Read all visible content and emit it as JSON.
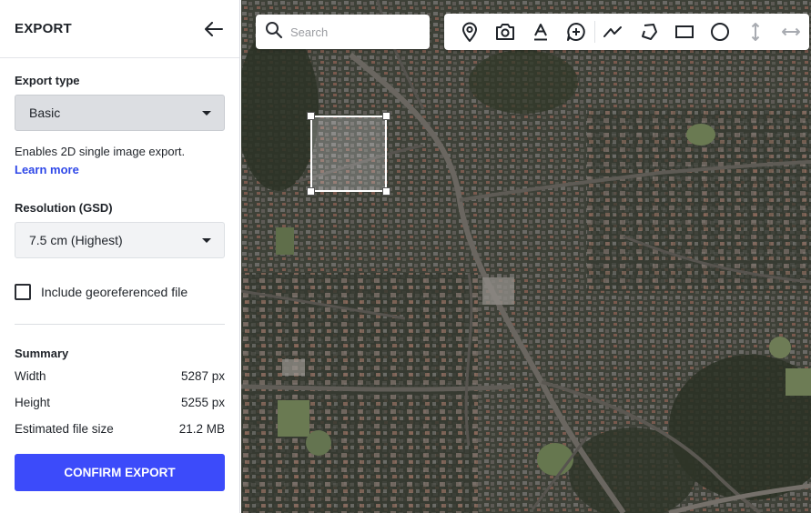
{
  "panel": {
    "title": "EXPORT",
    "export_type": {
      "label": "Export type",
      "selected": "Basic",
      "description": "Enables 2D single image export.",
      "learn_more": "Learn more"
    },
    "resolution": {
      "label": "Resolution (GSD)",
      "selected": "7.5 cm (Highest)"
    },
    "georef": {
      "label": "Include georeferenced file",
      "checked": false
    },
    "summary": {
      "title": "Summary",
      "rows": [
        {
          "label": "Width",
          "value": "5287 px"
        },
        {
          "label": "Height",
          "value": "5255 px"
        },
        {
          "label": "Estimated file size",
          "value": "21.2 MB"
        }
      ]
    },
    "confirm_label": "CONFIRM EXPORT"
  },
  "map": {
    "search_placeholder": "Search",
    "tools": [
      "pin-icon",
      "camera-icon",
      "text-icon",
      "add-comment-icon",
      "polyline-icon",
      "polygon-icon",
      "rectangle-icon",
      "circle-icon",
      "vertical-measure-icon",
      "horizontal-measure-icon"
    ]
  },
  "colors": {
    "accent": "#3c4bfa",
    "link": "#2f48e8",
    "select_bg": "#dcdee2"
  }
}
